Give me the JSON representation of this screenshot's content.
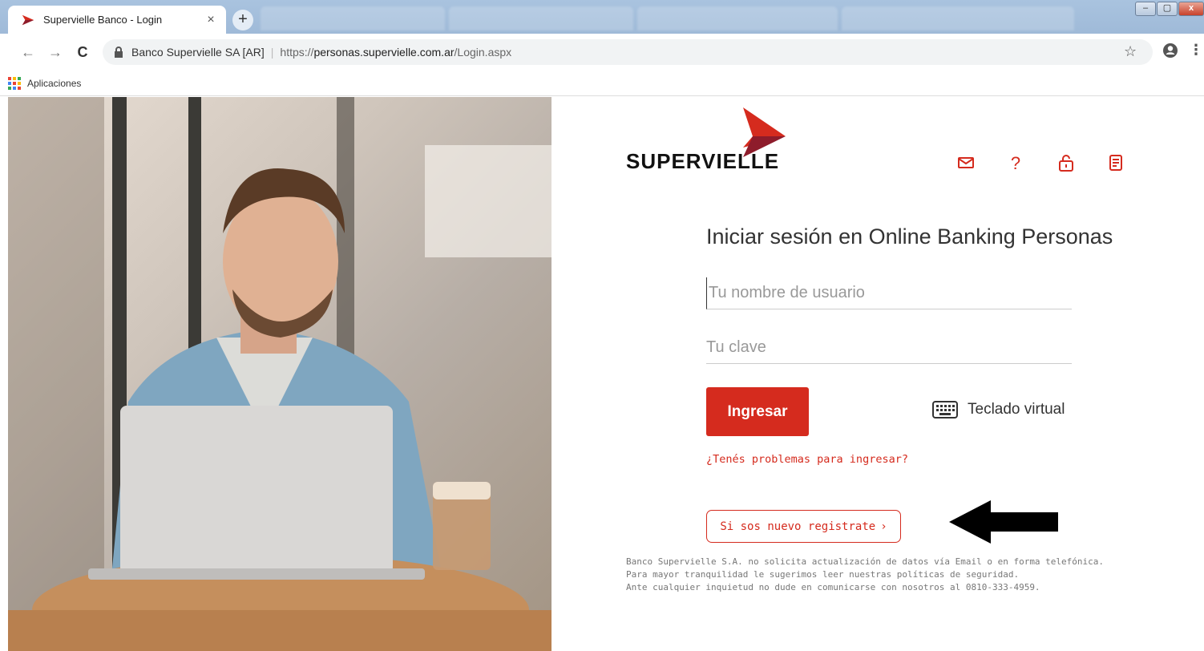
{
  "browser": {
    "tab_title": "Supervielle Banco - Login",
    "tab_close": "×",
    "new_tab": "+",
    "window_controls": {
      "minimize": "–",
      "maximize": "▢",
      "close": "x"
    },
    "address": {
      "org": "Banco Supervielle SA [AR]",
      "scheme": "https://",
      "domain": "personas.supervielle.com.ar",
      "path": "/Login.aspx"
    },
    "bookmarks": {
      "apps_label": "Aplicaciones"
    }
  },
  "brand": {
    "name": "SUPERVIELLE",
    "color": "#d52b1e"
  },
  "header_icons": [
    "mail-icon",
    "help-icon",
    "lock-icon",
    "document-icon"
  ],
  "login": {
    "heading": "Iniciar sesión en Online Banking Personas",
    "username_placeholder": "Tu nombre de usuario",
    "password_placeholder": "Tu clave",
    "submit_label": "Ingresar",
    "virtual_keyboard_label": "Teclado virtual",
    "trouble_link": "¿Tenés problemas para ingresar?",
    "register_label": "Si sos nuevo registrate",
    "register_chevron": "›"
  },
  "disclaimer": [
    "Banco Supervielle S.A. no solicita actualización de datos vía Email o en forma telefónica.",
    "Para mayor tranquilidad le sugerimos leer nuestras políticas de seguridad.",
    "Ante cualquier inquietud no dude en comunicarse con nosotros al 0810-333-4959."
  ]
}
